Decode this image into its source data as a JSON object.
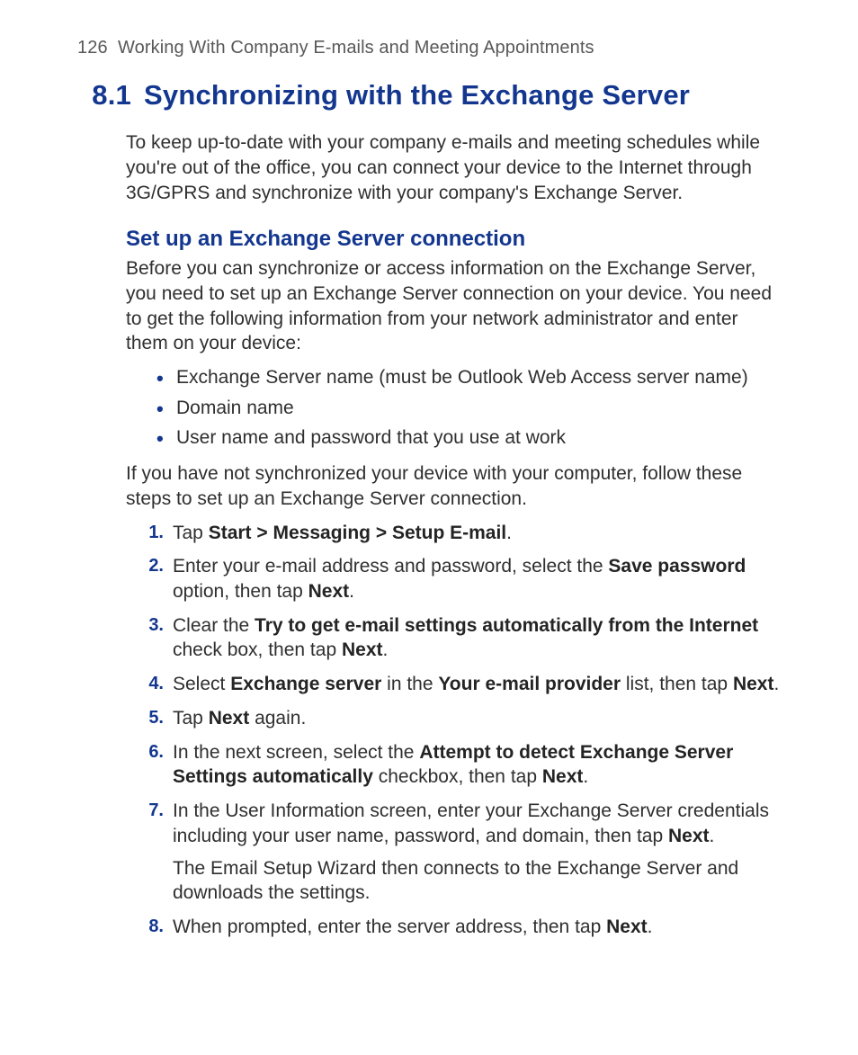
{
  "header": {
    "page_number": "126",
    "chapter_title": "Working With Company E-mails and Meeting Appointments"
  },
  "section": {
    "number": "8.1",
    "title": "Synchronizing with the Exchange Server",
    "intro": "To keep up-to-date with your company e-mails and meeting schedules while you're out of the office, you can connect your device to the Internet through 3G/GPRS and synchronize with your company's Exchange Server."
  },
  "subsection": {
    "title": "Set up an Exchange Server connection",
    "intro": "Before you can synchronize or access information on the Exchange Server, you need to set up an Exchange Server connection on your device. You need to get the following information from your network administrator and enter them on your device:",
    "bullets": [
      "Exchange Server name (must be Outlook Web Access server name)",
      "Domain name",
      "User name and password that you use at work"
    ],
    "after_bullets": "If you have not synchronized your device with your computer, follow these steps to set up an Exchange Server connection.",
    "steps": [
      {
        "num": "1.",
        "pre": "Tap ",
        "bold1": "Start > Messaging > Setup E-mail",
        "post1": "."
      },
      {
        "num": "2.",
        "pre": "Enter your e-mail address and password, select the ",
        "bold1": "Save password",
        "post1": " option, then tap ",
        "bold2": "Next",
        "post2": "."
      },
      {
        "num": "3.",
        "pre": "Clear the ",
        "bold1": "Try to get e-mail settings automatically from the Internet",
        "post1": " check box, then tap ",
        "bold2": "Next",
        "post2": "."
      },
      {
        "num": "4.",
        "pre": "Select ",
        "bold1": "Exchange server",
        "post1": " in the ",
        "bold2": "Your e-mail provider",
        "post2": " list, then tap ",
        "bold3": "Next",
        "post3": "."
      },
      {
        "num": "5.",
        "pre": "Tap ",
        "bold1": "Next",
        "post1": " again."
      },
      {
        "num": "6.",
        "pre": "In the next screen, select the ",
        "bold1": "Attempt to detect Exchange Server Settings automatically",
        "post1": " checkbox, then tap ",
        "bold2": "Next",
        "post2": "."
      },
      {
        "num": "7.",
        "pre": "In the User Information screen, enter your Exchange Server credentials including your user name, password, and domain, then tap ",
        "bold1": "Next",
        "post1": ".",
        "follow": "The Email Setup Wizard then connects to the Exchange Server and downloads the settings."
      },
      {
        "num": "8.",
        "pre": "When prompted, enter the server address, then tap ",
        "bold1": "Next",
        "post1": "."
      }
    ]
  }
}
